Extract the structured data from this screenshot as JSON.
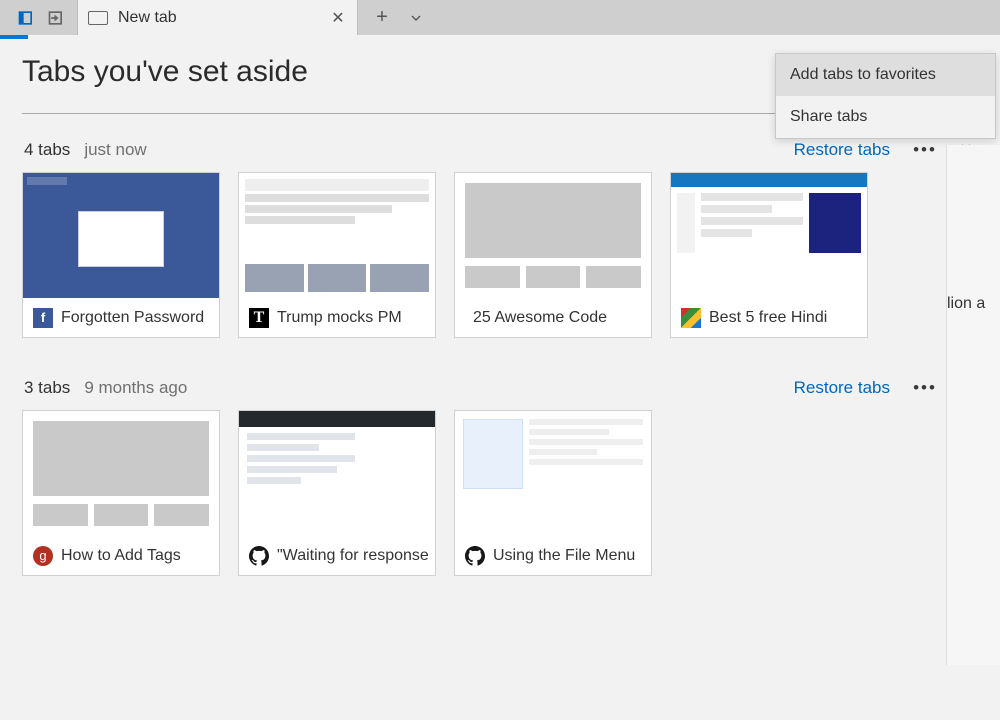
{
  "titlebar": {
    "tab_label": "New tab",
    "icons": {
      "aside": "set-aside-icon",
      "restore_aside": "view-aside-icon",
      "newtab": "plus-icon",
      "chev": "chevron-down-icon",
      "close": "close-icon"
    }
  },
  "context_menu": {
    "items": [
      {
        "label": "Add tabs to favorites",
        "highlight": true
      },
      {
        "label": "Share tabs",
        "highlight": false
      }
    ]
  },
  "page": {
    "title": "Tabs you've set aside"
  },
  "groups": [
    {
      "count": "4 tabs",
      "time": "just now",
      "restore": "Restore tabs",
      "items": [
        {
          "title": "Forgotten Password",
          "favicon": "fb",
          "thumb": "fb"
        },
        {
          "title": "Trump mocks PM",
          "favicon": "nyt",
          "thumb": "ny"
        },
        {
          "title": "25 Awesome Code",
          "favicon": "",
          "thumb": "gen"
        },
        {
          "title": "Best 5 free Hindi",
          "favicon": "win",
          "thumb": "twc"
        }
      ]
    },
    {
      "count": "3 tabs",
      "time": "9 months ago",
      "restore": "Restore tabs",
      "items": [
        {
          "title": "How to Add Tags",
          "favicon": "g",
          "thumb": "gen"
        },
        {
          "title": "\"Waiting for response",
          "favicon": "gh",
          "thumb": "gh"
        },
        {
          "title": "Using the File Menu",
          "favicon": "gh",
          "thumb": "win"
        }
      ]
    }
  ],
  "underpage": {
    "text": "lion  a"
  }
}
